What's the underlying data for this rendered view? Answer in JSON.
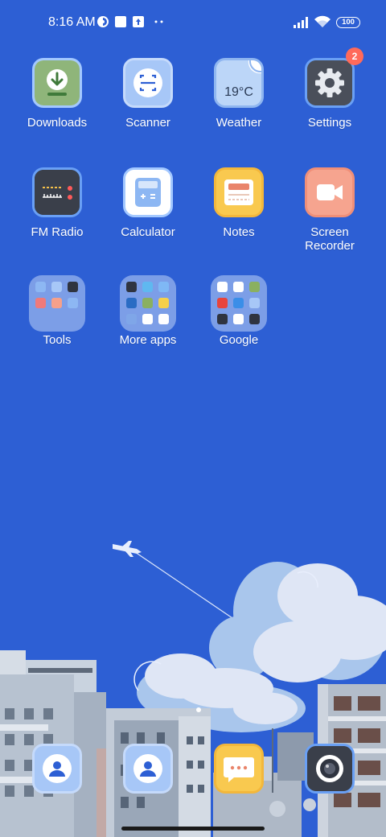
{
  "status_bar": {
    "time": "8:16 AM",
    "battery": "100"
  },
  "apps": [
    {
      "label": "Downloads",
      "icon": "download-icon"
    },
    {
      "label": "Scanner",
      "icon": "scanner-icon"
    },
    {
      "label": "Weather",
      "icon": "weather-icon",
      "temperature": "19°C"
    },
    {
      "label": "Settings",
      "icon": "gear-icon",
      "badge": "2"
    },
    {
      "label": "FM Radio",
      "icon": "radio-icon"
    },
    {
      "label": "Calculator",
      "icon": "calculator-icon"
    },
    {
      "label": "Notes",
      "icon": "notes-icon"
    },
    {
      "label": "Screen Recorder",
      "icon": "video-camera-icon"
    }
  ],
  "folders": [
    {
      "label": "Tools"
    },
    {
      "label": "More apps"
    },
    {
      "label": "Google"
    }
  ],
  "dock": [
    {
      "name": "contacts",
      "icon": "person-icon"
    },
    {
      "name": "phone",
      "icon": "person-icon"
    },
    {
      "name": "messages",
      "icon": "chat-bubble-icon"
    },
    {
      "name": "camera",
      "icon": "camera-lens-icon"
    }
  ],
  "colors": {
    "wallpaper_sky": "#2d5fd4",
    "badge": "#ff6a5a"
  }
}
